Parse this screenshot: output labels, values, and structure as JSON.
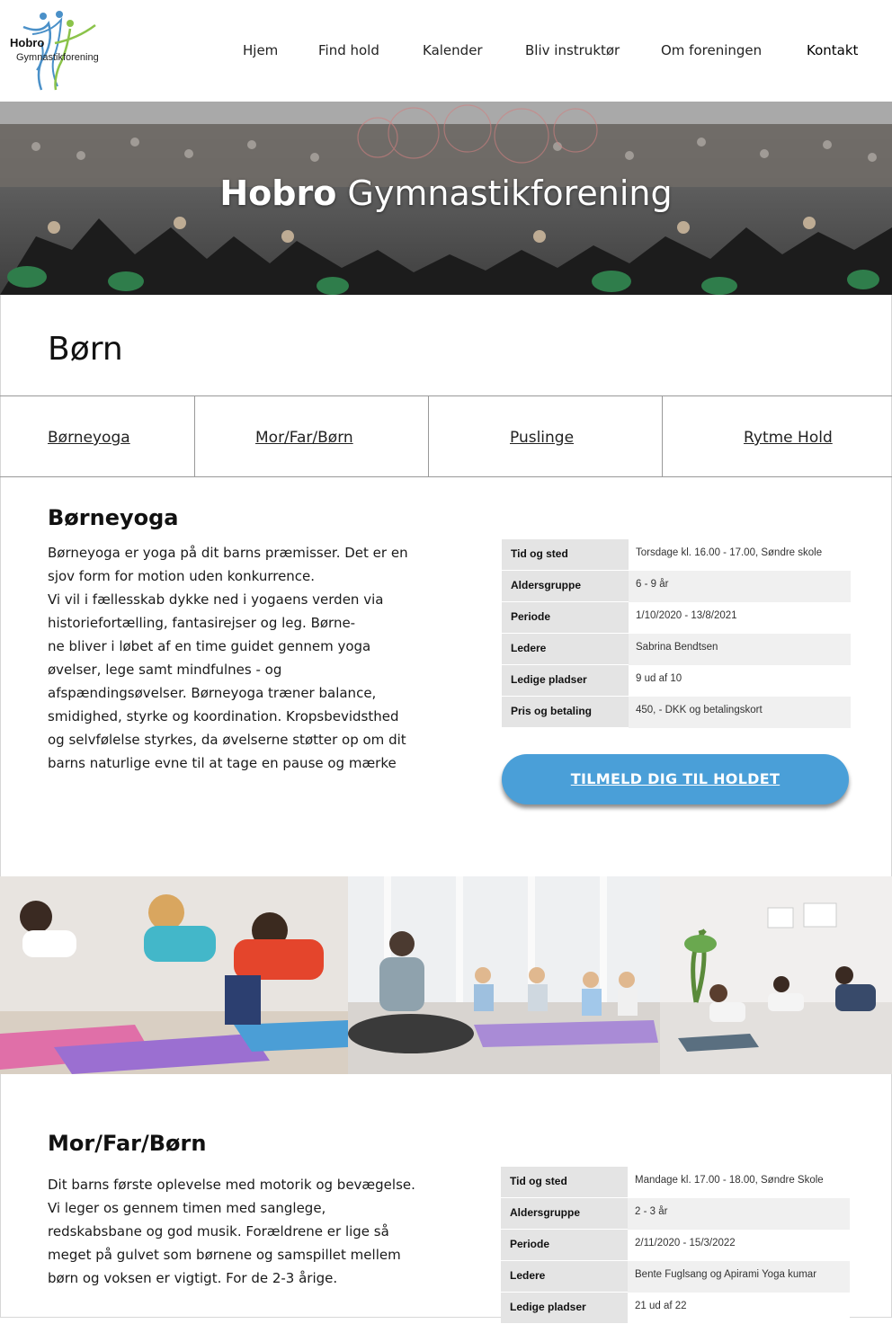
{
  "logo": {
    "title": "Hobro",
    "subtitle": "Gymnastikforening"
  },
  "nav": [
    {
      "label": "Hjem"
    },
    {
      "label": "Find hold"
    },
    {
      "label": "Kalender"
    },
    {
      "label": "Bliv instruktør"
    },
    {
      "label": "Om foreningen"
    },
    {
      "label": "Kontakt"
    }
  ],
  "hero": {
    "title_bold": "Hobro",
    "title_light": "Gymnastikforening"
  },
  "page_title": "Børn",
  "tabs": [
    {
      "label": "Børneyoga"
    },
    {
      "label": "Mor/Far/Børn"
    },
    {
      "label": "Puslinge"
    },
    {
      "label": "Rytme Hold"
    }
  ],
  "sections": [
    {
      "heading": "Børneyoga",
      "description_lines": [
        "Børneyoga er yoga på dit barns præmisser. Det er en",
        "sjov form for motion uden konkurrence.",
        "Vi vil i fællesskab dykke ned i yogaens verden via",
        "historiefortælling, fantasirejser og leg. Børne-",
        "ne bliver i løbet af en time guidet gennem yoga",
        "øvelser, lege samt mindfulnes - og",
        "afspændingsøvelser. Børneyoga træner balance,",
        "smidighed, styrke og koordination. Kropsbevidsthed",
        "og selvfølelse styrkes, da øvelserne støtter op om dit",
        "barns naturlige evne til at tage en pause og mærke"
      ],
      "info": [
        {
          "label": "Tid og sted",
          "value": "Torsdage kl. 16.00 - 17.00, Søndre skole"
        },
        {
          "label": "Aldersgruppe",
          "value": " 6 - 9 år"
        },
        {
          "label": "Periode",
          "value": "1/10/2020 - 13/8/2021"
        },
        {
          "label": "Ledere",
          "value": "Sabrina Bendtsen"
        },
        {
          "label": "Ledige pladser",
          "value": " 9 ud af 10"
        },
        {
          "label": "Pris og betaling",
          "value": "450, - DKK og betalingskort"
        }
      ],
      "cta": "TILMELD DIG TIL HOLDET"
    },
    {
      "heading": "Mor/Far/Børn",
      "description_lines": [
        "Dit barns første oplevelse med motorik og bevægelse.",
        "Vi leger os gennem timen med sanglege,",
        "redskabsbane og god musik. Forældrene er lige så",
        "meget på gulvet som børnene og samspillet mellem",
        "børn og voksen er vigtigt. For de 2-3 årige."
      ],
      "info": [
        {
          "label": "Tid og sted",
          "value": "Mandage kl. 17.00 - 18.00, Søndre Skole"
        },
        {
          "label": "Aldersgruppe",
          "value": " 2 - 3 år"
        },
        {
          "label": "Periode",
          "value": "2/11/2020 - 15/3/2022"
        },
        {
          "label": "Ledere",
          "value": "Bente Fuglsang og Apirami Yoga kumar"
        },
        {
          "label": "Ledige pladser",
          "value": " 21 ud af 22"
        }
      ]
    }
  ],
  "colors": {
    "accent": "#4a9fd8",
    "table_label_bg": "#e4e4e4"
  }
}
